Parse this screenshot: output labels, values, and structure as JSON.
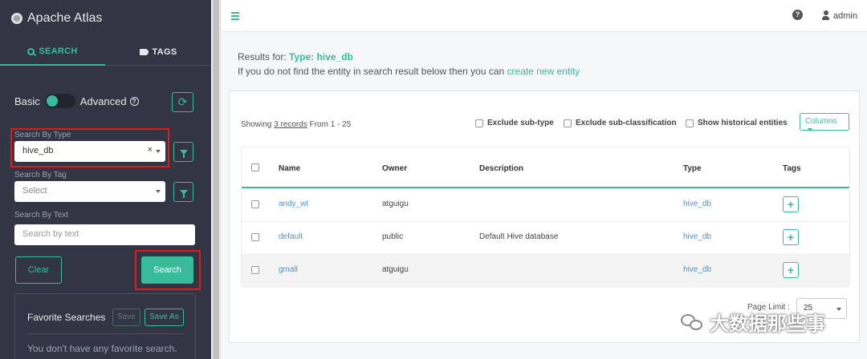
{
  "sidebar": {
    "brand": "Apache Atlas",
    "tabs": {
      "search": "SEARCH",
      "tags": "TAGS"
    },
    "mode": {
      "basic": "Basic",
      "advanced": "Advanced"
    },
    "search_by_type": {
      "label": "Search By Type",
      "value": "hive_db",
      "clear": "×"
    },
    "search_by_tag": {
      "label": "Search By Tag",
      "placeholder": "Select"
    },
    "search_by_text": {
      "label": "Search By Text",
      "placeholder": "Search by text"
    },
    "clear_label": "Clear",
    "search_label": "Search",
    "favorites": {
      "title": "Favorite Searches",
      "save": "Save",
      "save_as": "Save As",
      "empty": "You don't have any favorite search."
    }
  },
  "topbar": {
    "help": "?",
    "user": "admin"
  },
  "results": {
    "prefix": "Results for:",
    "type_text": "Type: hive_db",
    "hint": "If you do not find the entity in search result below then you can",
    "hint_link": "create new entity"
  },
  "table_controls": {
    "showing_prefix": "Showing",
    "records_link": "3 records",
    "range": "From 1 - 25",
    "exclude_subtype": "Exclude sub-type",
    "exclude_subclass": "Exclude sub-classification",
    "show_historical": "Show historical entities",
    "columns": "Columns"
  },
  "table": {
    "headers": [
      "Name",
      "Owner",
      "Description",
      "Type",
      "Tags"
    ],
    "rows": [
      {
        "name": "andy_wt",
        "owner": "atguigu",
        "description": "",
        "type": "hive_db",
        "tag_add": "+"
      },
      {
        "name": "default",
        "owner": "public",
        "description": "Default Hive database",
        "type": "hive_db",
        "tag_add": "+"
      },
      {
        "name": "gmall",
        "owner": "atguigu",
        "description": "",
        "type": "hive_db",
        "tag_add": "+"
      }
    ]
  },
  "pagination": {
    "label": "Page Limit :",
    "value": "25"
  },
  "watermark": {
    "text": "大数据那些事",
    "icon": "wechat-icon"
  },
  "colors": {
    "sidebar_bg": "#323544",
    "accent": "#38bb9b",
    "link": "#4a90d9",
    "highlight_box": "#e0191c"
  }
}
